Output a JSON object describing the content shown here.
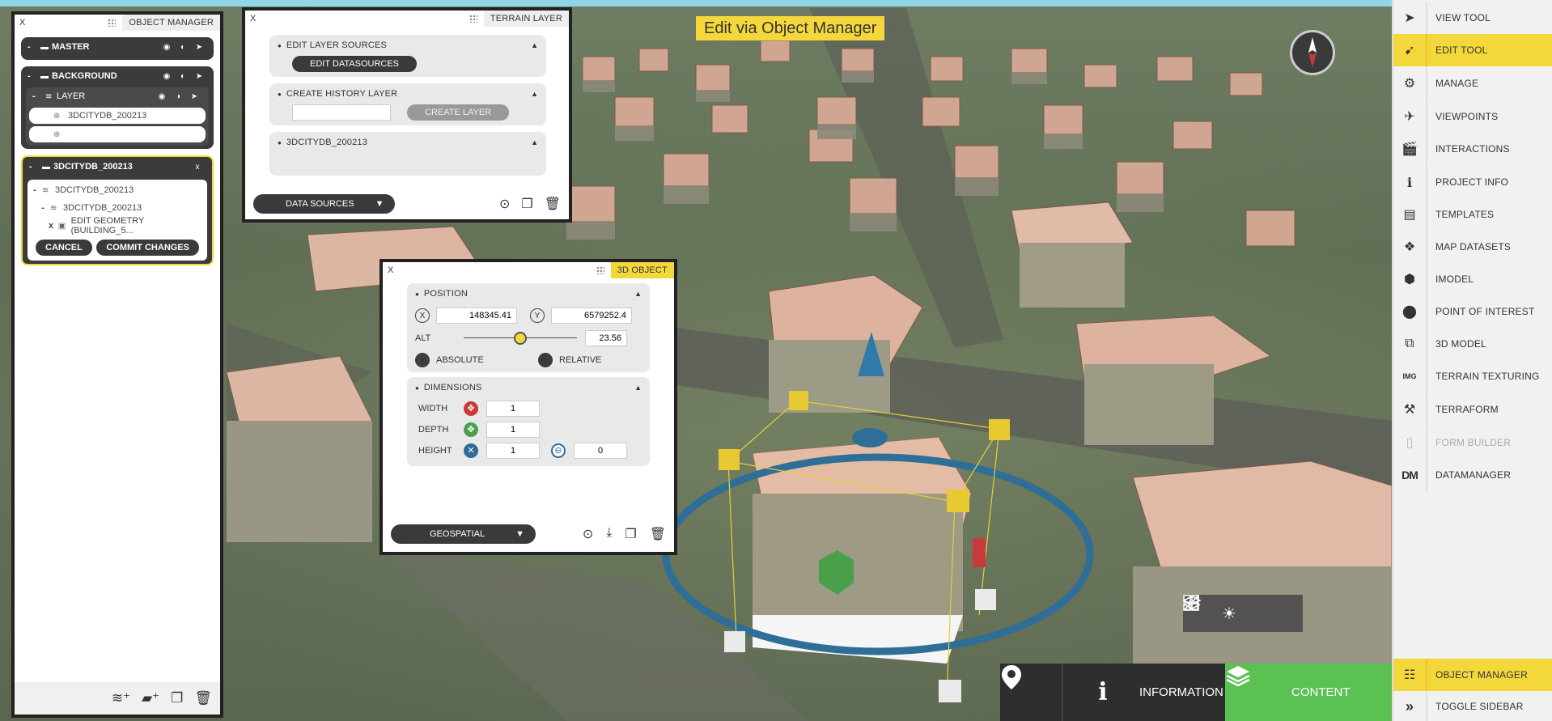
{
  "scene": {
    "banner": "Edit via Object Manager"
  },
  "object_manager": {
    "close": "X",
    "title": "OBJECT MANAGER",
    "master": {
      "toggle": "-",
      "label": "MASTER"
    },
    "background": {
      "toggle": "-",
      "label": "BACKGROUND",
      "layer": {
        "toggle": "-",
        "label": "LAYER"
      },
      "items": [
        "3DCITYDB_200213",
        ""
      ]
    },
    "city_block": {
      "toggle": "-",
      "label": "3DCITYDB_200213",
      "close": "x",
      "rows": [
        {
          "toggle": "-",
          "label": "3DCITYDB_200213"
        },
        {
          "toggle": "-",
          "label": "3DCITYDB_200213"
        },
        {
          "toggle": "x",
          "label": "EDIT GEOMETRY (BUILDING_5..."
        }
      ],
      "cancel": "CANCEL",
      "commit": "COMMIT CHANGES"
    }
  },
  "terrain_layer": {
    "close": "X",
    "title": "TERRAIN LAYER",
    "edit_sources": {
      "title": "EDIT LAYER SOURCES",
      "button": "EDIT DATASOURCES"
    },
    "history": {
      "title": "CREATE HISTORY LAYER",
      "input_value": "",
      "button": "CREATE LAYER"
    },
    "db": {
      "title": "3DCITYDB_200213"
    },
    "dropdown": "DATA SOURCES"
  },
  "object3d": {
    "close": "X",
    "title": "3D OBJECT",
    "position": {
      "title": "POSITION",
      "x_label": "X",
      "x": "148345.41",
      "y_label": "Y",
      "y": "6579252.4",
      "alt_label": "ALT",
      "alt": "23.56",
      "alt_slider": 0.5,
      "absolute": "ABSOLUTE",
      "relative": "RELATIVE"
    },
    "dimensions": {
      "title": "DIMENSIONS",
      "width_label": "WIDTH",
      "width": "1",
      "depth_label": "DEPTH",
      "depth": "1",
      "height_label": "HEIGHT",
      "height": "1",
      "height2": "0"
    },
    "dropdown": "GEOSPATIAL"
  },
  "bottom": {
    "information": "INFORMATION",
    "content": "CONTENT"
  },
  "sidebar": {
    "items": [
      {
        "label": "VIEW TOOL",
        "icon": "cursor-icon"
      },
      {
        "label": "EDIT TOOL",
        "icon": "edit-cursor-icon"
      },
      {
        "label": "MANAGE",
        "icon": "gear-icon"
      },
      {
        "label": "VIEWPOINTS",
        "icon": "paper-plane-icon"
      },
      {
        "label": "INTERACTIONS",
        "icon": "clapper-icon"
      },
      {
        "label": "PROJECT INFO",
        "icon": "info-icon"
      },
      {
        "label": "TEMPLATES",
        "icon": "template-icon"
      },
      {
        "label": "MAP DATASETS",
        "icon": "grid-icon"
      },
      {
        "label": "IMODEL",
        "icon": "imodel-icon"
      },
      {
        "label": "POINT OF INTEREST",
        "icon": "pin-icon"
      },
      {
        "label": "3D MODEL",
        "icon": "cube-icon"
      },
      {
        "label": "TERRAIN TEXTURING",
        "icon": "img-icon"
      },
      {
        "label": "TERRAFORM",
        "icon": "terraform-icon"
      },
      {
        "label": "FORM BUILDER",
        "icon": "form-icon"
      },
      {
        "label": "DATAMANAGER",
        "icon": "dm-icon"
      }
    ],
    "object_manager": "OBJECT MANAGER",
    "toggle": "TOGGLE SIDEBAR",
    "dm_glyph": "DM",
    "img_glyph": "IMG"
  },
  "colors": {
    "accent": "#f4d83b",
    "content_green": "#5bc152",
    "panel_dark": "#3a3a3a",
    "gizmo_blue": "#2f6e97"
  }
}
